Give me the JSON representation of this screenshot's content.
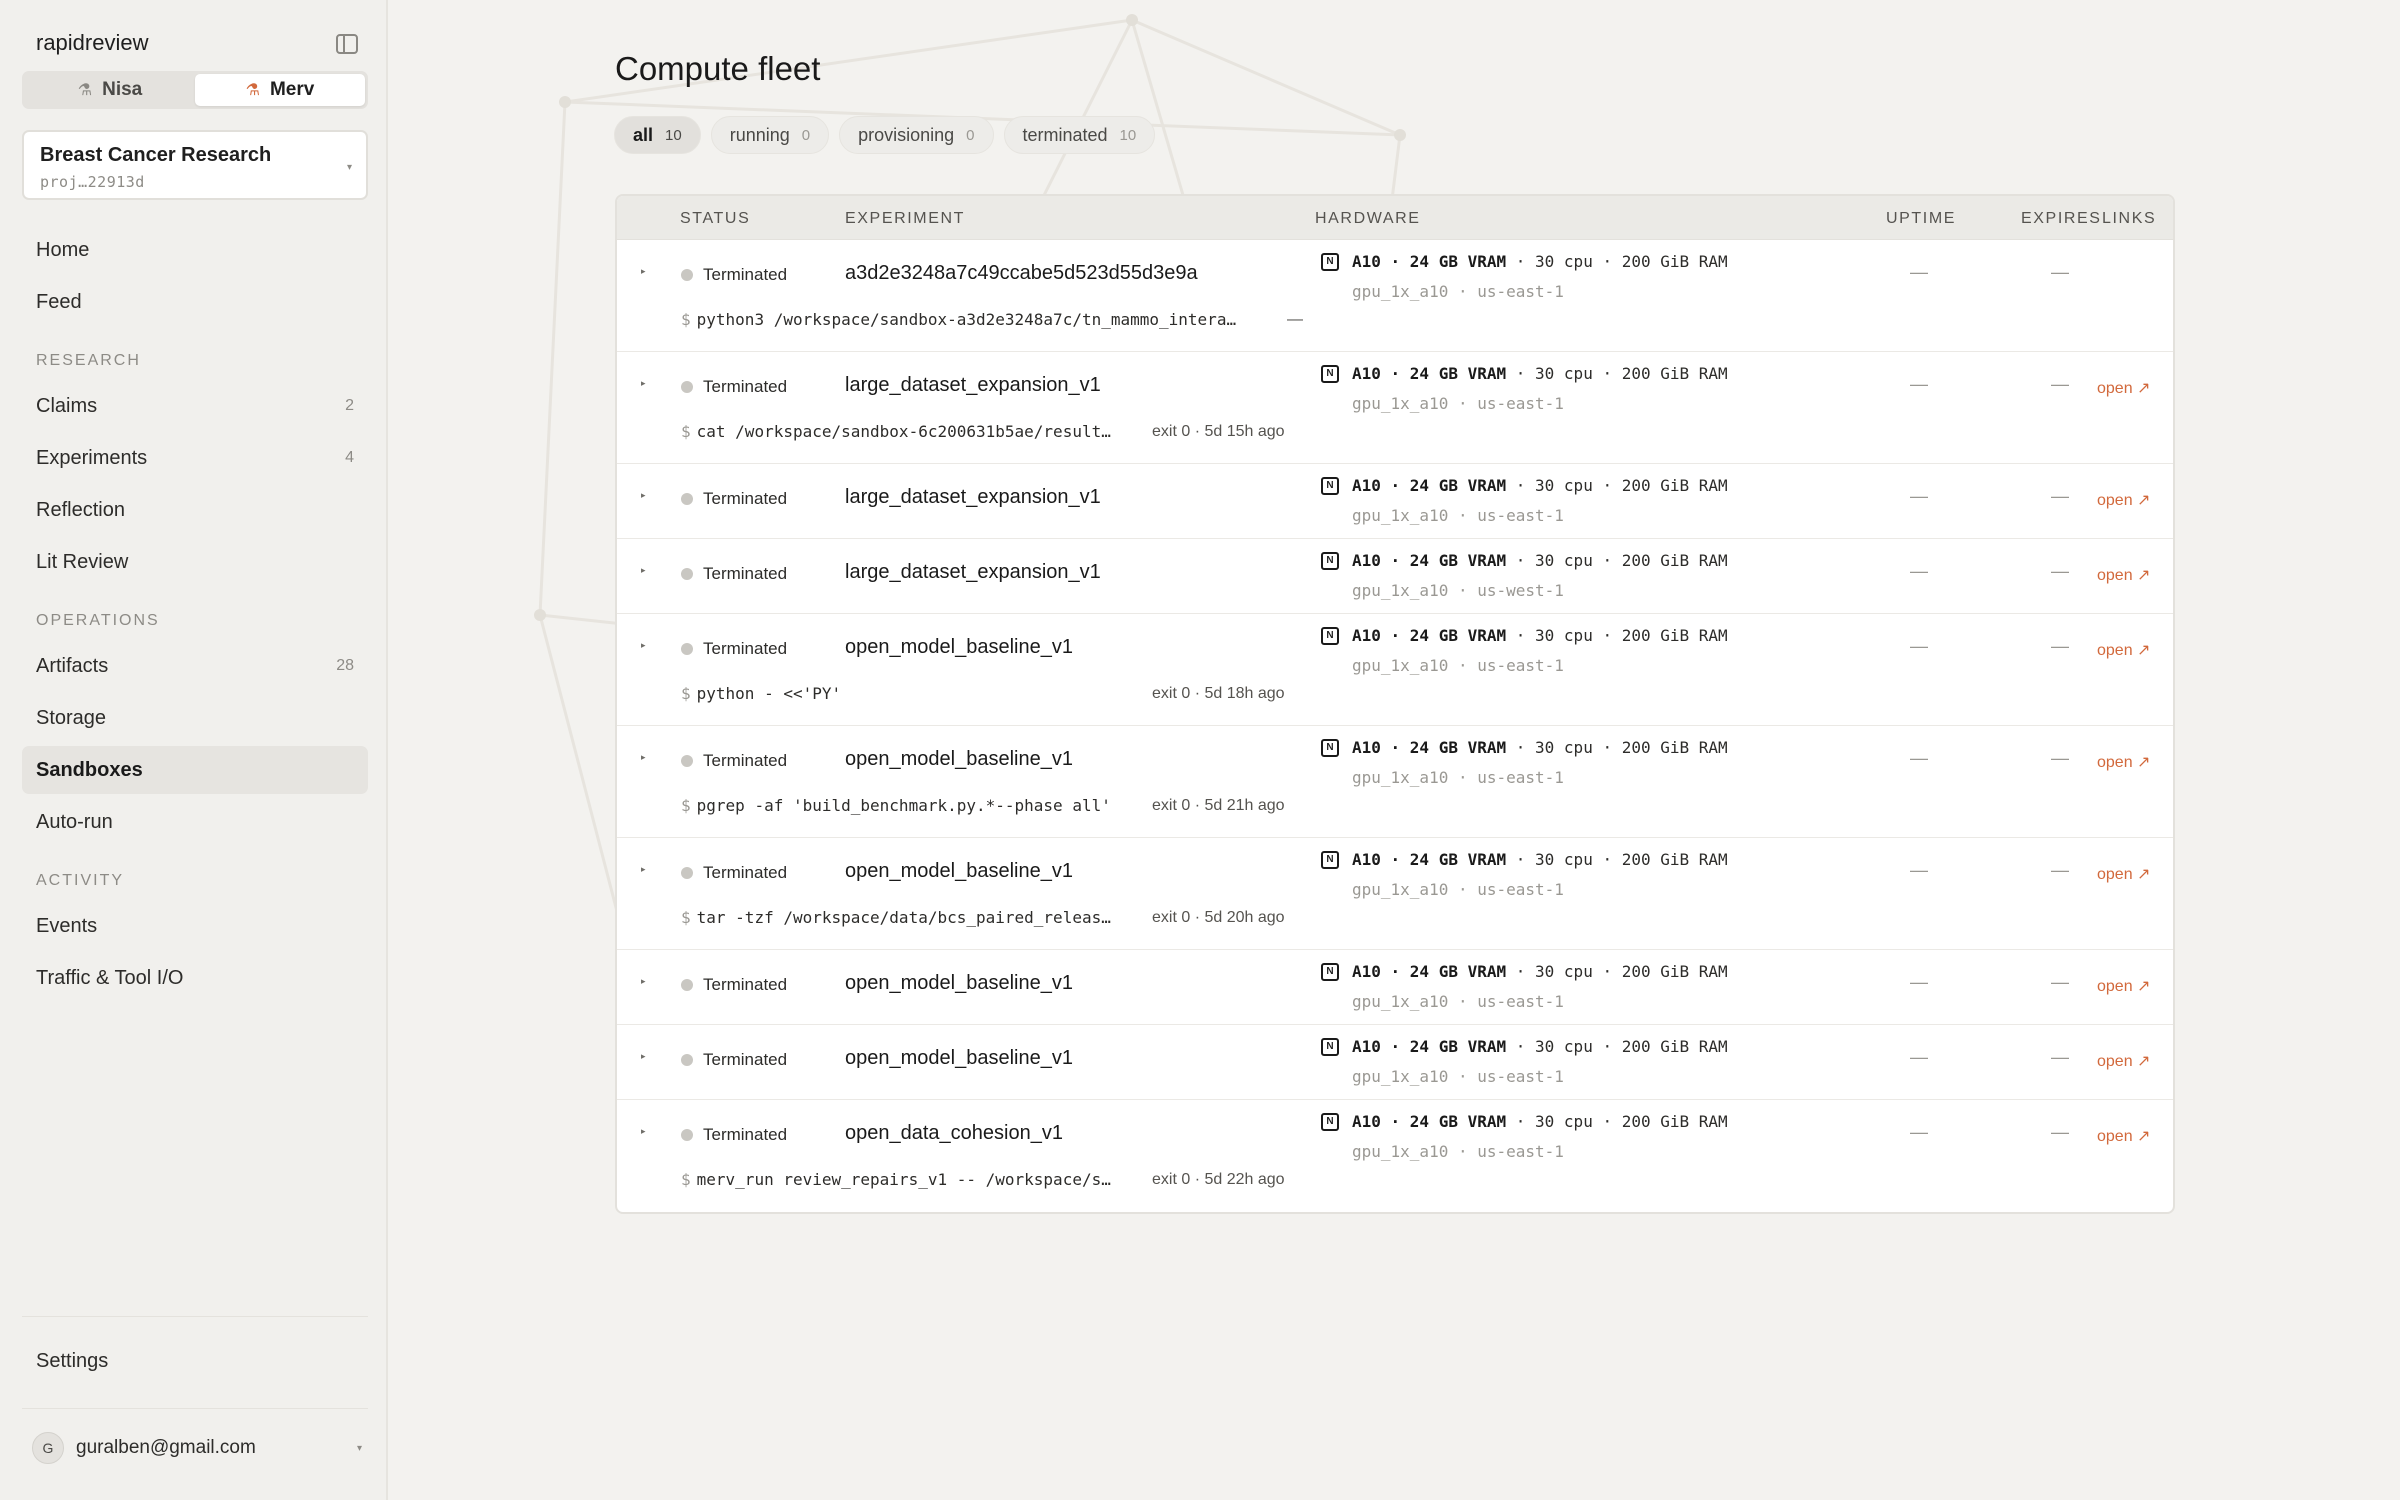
{
  "app": {
    "brand": "rapidreview",
    "users": [
      {
        "name": "Nisa",
        "active": false
      },
      {
        "name": "Merv",
        "active": true
      }
    ],
    "project": {
      "name": "Breast Cancer Research",
      "id": "proj…22913d"
    }
  },
  "nav": {
    "home": "Home",
    "feed": "Feed",
    "research_label": "RESEARCH",
    "claims": "Claims",
    "claims_count": "2",
    "experiments": "Experiments",
    "experiments_count": "4",
    "reflection": "Reflection",
    "lit_review": "Lit Review",
    "operations_label": "OPERATIONS",
    "artifacts": "Artifacts",
    "artifacts_count": "28",
    "storage": "Storage",
    "sandboxes": "Sandboxes",
    "auto_run": "Auto-run",
    "activity_label": "ACTIVITY",
    "events": "Events",
    "traffic": "Traffic & Tool I/O",
    "settings": "Settings"
  },
  "account": {
    "initial": "G",
    "email": "guralben@gmail.com"
  },
  "page": {
    "title": "Compute fleet",
    "filters": [
      {
        "label": "all",
        "count": "10",
        "active": true
      },
      {
        "label": "running",
        "count": "0",
        "active": false
      },
      {
        "label": "provisioning",
        "count": "0",
        "active": false
      },
      {
        "label": "terminated",
        "count": "10",
        "active": false
      }
    ]
  },
  "table": {
    "headers": {
      "status": "STATUS",
      "experiment": "EXPERIMENT",
      "hardware": "HARDWARE",
      "uptime": "UPTIME",
      "expires": "EXPIRES",
      "links": "LINKS"
    },
    "rows": [
      {
        "status": "Terminated",
        "experiment": "a3d2e3248a7c49ccabe5d523d55d3e9a",
        "hw_bold": "A10 · 24 GB VRAM",
        "hw_rest": " · 30 cpu · 200 GiB RAM",
        "hw_sub": "gpu_1x_a10 · us-east-1",
        "uptime": "—",
        "expires": "—",
        "link": "",
        "cmd": "python3 /workspace/sandbox-a3d2e3248a7c/tn_mammo_intera…",
        "cmd_meta": "—"
      },
      {
        "status": "Terminated",
        "experiment": "large_dataset_expansion_v1",
        "hw_bold": "A10 · 24 GB VRAM",
        "hw_rest": " · 30 cpu · 200 GiB RAM",
        "hw_sub": "gpu_1x_a10 · us-east-1",
        "uptime": "—",
        "expires": "—",
        "link": "open ↗",
        "cmd": "cat /workspace/sandbox-6c200631b5ae/result…",
        "cmd_meta": "exit 0 · 5d 15h ago"
      },
      {
        "status": "Terminated",
        "experiment": "large_dataset_expansion_v1",
        "hw_bold": "A10 · 24 GB VRAM",
        "hw_rest": " · 30 cpu · 200 GiB RAM",
        "hw_sub": "gpu_1x_a10 · us-east-1",
        "uptime": "—",
        "expires": "—",
        "link": "open ↗",
        "cmd": "",
        "cmd_meta": ""
      },
      {
        "status": "Terminated",
        "experiment": "large_dataset_expansion_v1",
        "hw_bold": "A10 · 24 GB VRAM",
        "hw_rest": " · 30 cpu · 200 GiB RAM",
        "hw_sub": "gpu_1x_a10 · us-west-1",
        "uptime": "—",
        "expires": "—",
        "link": "open ↗",
        "cmd": "",
        "cmd_meta": ""
      },
      {
        "status": "Terminated",
        "experiment": "open_model_baseline_v1",
        "hw_bold": "A10 · 24 GB VRAM",
        "hw_rest": " · 30 cpu · 200 GiB RAM",
        "hw_sub": "gpu_1x_a10 · us-east-1",
        "uptime": "—",
        "expires": "—",
        "link": "open ↗",
        "cmd": "python - <<'PY'",
        "cmd_meta": "exit 0 · 5d 18h ago"
      },
      {
        "status": "Terminated",
        "experiment": "open_model_baseline_v1",
        "hw_bold": "A10 · 24 GB VRAM",
        "hw_rest": " · 30 cpu · 200 GiB RAM",
        "hw_sub": "gpu_1x_a10 · us-east-1",
        "uptime": "—",
        "expires": "—",
        "link": "open ↗",
        "cmd": "pgrep -af 'build_benchmark.py.*--phase all'",
        "cmd_meta": "exit 0 · 5d 21h ago"
      },
      {
        "status": "Terminated",
        "experiment": "open_model_baseline_v1",
        "hw_bold": "A10 · 24 GB VRAM",
        "hw_rest": " · 30 cpu · 200 GiB RAM",
        "hw_sub": "gpu_1x_a10 · us-east-1",
        "uptime": "—",
        "expires": "—",
        "link": "open ↗",
        "cmd": "tar -tzf /workspace/data/bcs_paired_releas…",
        "cmd_meta": "exit 0 · 5d 20h ago"
      },
      {
        "status": "Terminated",
        "experiment": "open_model_baseline_v1",
        "hw_bold": "A10 · 24 GB VRAM",
        "hw_rest": " · 30 cpu · 200 GiB RAM",
        "hw_sub": "gpu_1x_a10 · us-east-1",
        "uptime": "—",
        "expires": "—",
        "link": "open ↗",
        "cmd": "",
        "cmd_meta": ""
      },
      {
        "status": "Terminated",
        "experiment": "open_model_baseline_v1",
        "hw_bold": "A10 · 24 GB VRAM",
        "hw_rest": " · 30 cpu · 200 GiB RAM",
        "hw_sub": "gpu_1x_a10 · us-east-1",
        "uptime": "—",
        "expires": "—",
        "link": "open ↗",
        "cmd": "",
        "cmd_meta": ""
      },
      {
        "status": "Terminated",
        "experiment": "open_data_cohesion_v1",
        "hw_bold": "A10 · 24 GB VRAM",
        "hw_rest": " · 30 cpu · 200 GiB RAM",
        "hw_sub": "gpu_1x_a10 · us-east-1",
        "uptime": "—",
        "expires": "—",
        "link": "open ↗",
        "cmd": "merv_run review_repairs_v1 -- /workspace/s…",
        "cmd_meta": "exit 0 · 5d 22h ago"
      }
    ]
  }
}
